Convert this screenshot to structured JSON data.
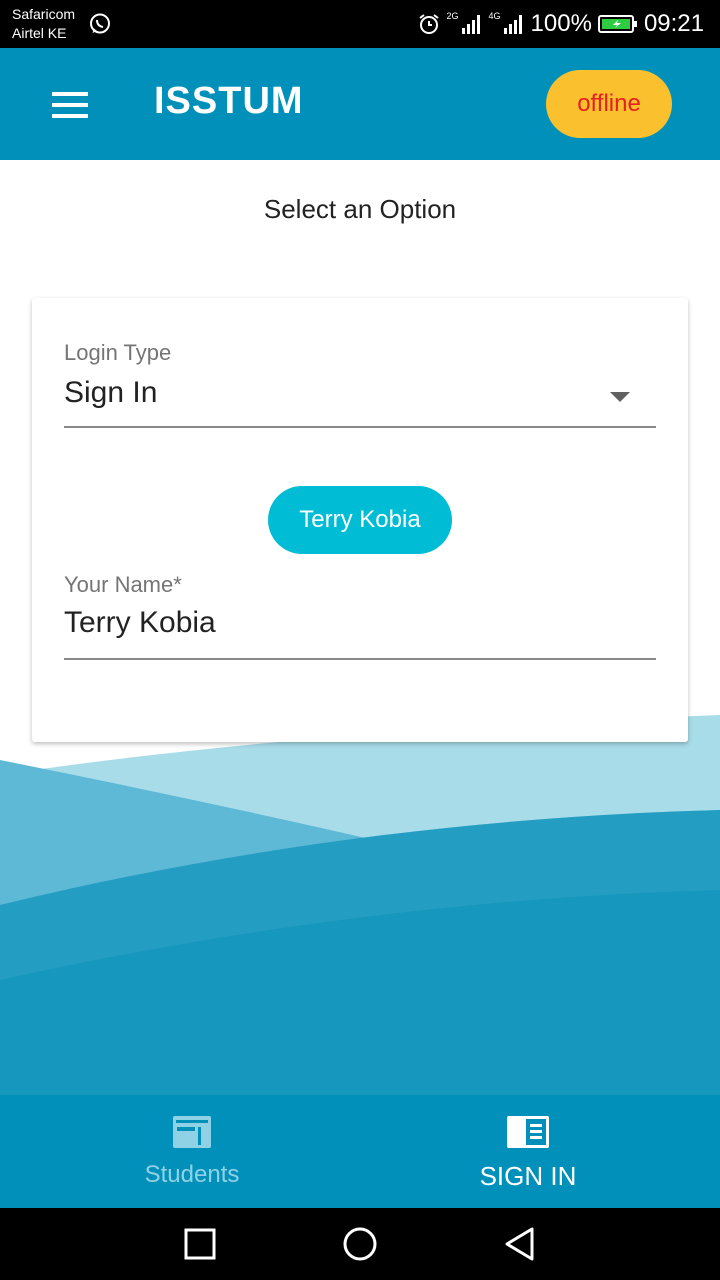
{
  "status_bar": {
    "carrier1": "Safaricom",
    "carrier2": "Airtel KE",
    "network1": "2G",
    "network2": "4G",
    "battery": "100%",
    "time": "09:21"
  },
  "app_bar": {
    "title": "ISSTUM",
    "status_badge": "offline"
  },
  "main": {
    "heading": "Select an Option",
    "login_type": {
      "label": "Login Type",
      "value": "Sign In"
    },
    "name_chip": "Terry Kobia",
    "your_name": {
      "label": "Your Name*",
      "value": "Terry Kobia"
    }
  },
  "bottom_nav": {
    "items": [
      {
        "label": "Students",
        "icon": "students-icon",
        "active": false
      },
      {
        "label": "SIGN IN",
        "icon": "sign-in-icon",
        "active": true
      }
    ]
  },
  "colors": {
    "primary": "#0090b9",
    "accent_chip": "#00bcd4",
    "offline_badge": "#fbc02d",
    "offline_text": "#e52020"
  }
}
